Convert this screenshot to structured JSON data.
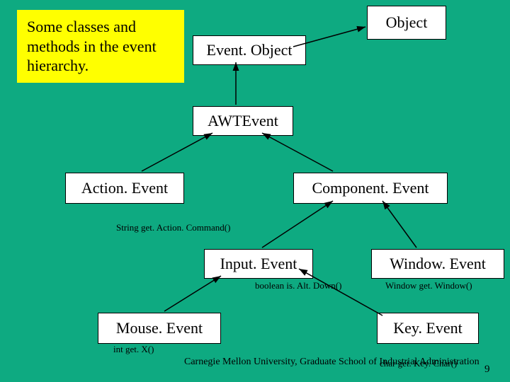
{
  "note": "Some classes and methods in the event hierarchy.",
  "nodes": {
    "object": "Object",
    "eventObject": "Event. Object",
    "awtEvent": "AWTEvent",
    "actionEvent": "Action. Event",
    "componentEvent": "Component. Event",
    "inputEvent": "Input. Event",
    "windowEvent": "Window. Event",
    "mouseEvent": "Mouse. Event",
    "keyEvent": "Key. Event"
  },
  "methods": {
    "getActionCommand": "String get. Action. Command()",
    "isAltDown": "boolean is. Alt. Down()",
    "getWindow": "Window get. Window()",
    "getX": "int get. X()",
    "getKeyChar": "char get. Key. Char()"
  },
  "footer": {
    "affiliation": "Carnegie Mellon University, Graduate School of Industrial Administration",
    "page": "9"
  }
}
